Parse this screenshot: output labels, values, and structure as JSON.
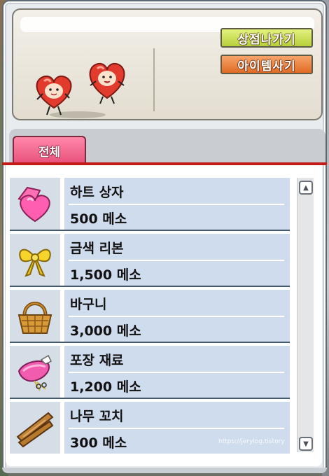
{
  "shop": {
    "exit_label": "상점나가기",
    "buy_label": "아이템사기",
    "tab_all": "전체"
  },
  "items": [
    {
      "name": "하트 상자",
      "price": "500 메소",
      "icon": "heart-box-icon"
    },
    {
      "name": "금색 리본",
      "price": "1,500 메소",
      "icon": "gold-ribbon-icon"
    },
    {
      "name": "바구니",
      "price": "3,000 메소",
      "icon": "basket-icon"
    },
    {
      "name": "포장 재료",
      "price": "1,200 메소",
      "icon": "wrapping-material-icon"
    },
    {
      "name": "나무 꼬치",
      "price": "300 메소",
      "icon": "wooden-skewer-icon"
    }
  ],
  "watermark": "https://jerylog.tistory",
  "colors": {
    "exit_button": "#c4d94a",
    "buy_button": "#ee8030",
    "active_tab": "#f06088",
    "tab_underline": "#c41a1a",
    "item_row": "#cfdced"
  }
}
